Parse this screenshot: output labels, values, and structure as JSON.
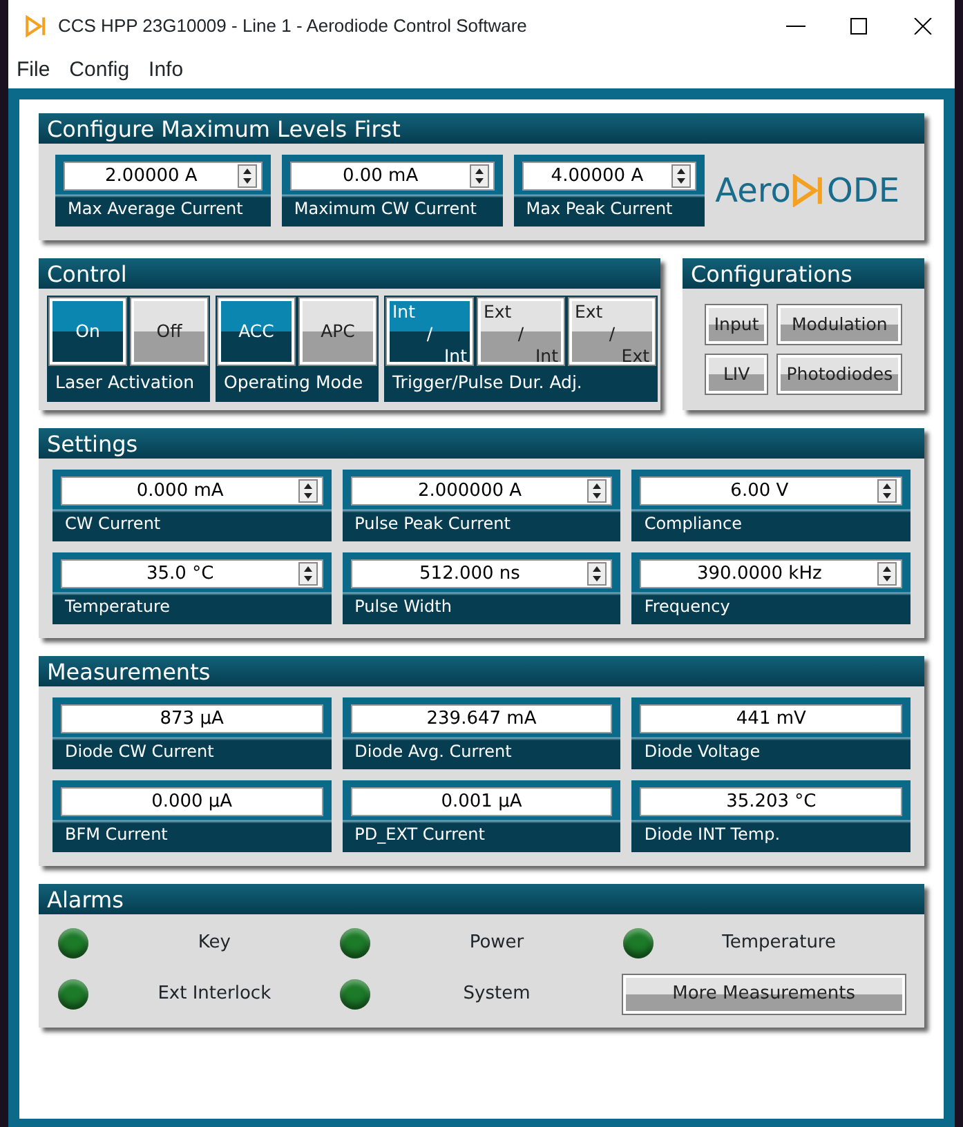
{
  "window": {
    "title": "CCS HPP 23G10009 - Line 1 - Aerodiode Control Software"
  },
  "menu": [
    "File",
    "Config",
    "Info"
  ],
  "max_levels": {
    "title": "Configure Maximum Levels First",
    "fields": [
      {
        "value": "2.00000 A",
        "label": "Max Average Current"
      },
      {
        "value": "0.00 mA",
        "label": "Maximum CW Current"
      },
      {
        "value": "4.00000 A",
        "label": "Max Peak Current"
      }
    ],
    "logo": {
      "left": "Aero",
      "right": "ODE"
    }
  },
  "control": {
    "title": "Control",
    "groups": [
      {
        "label": "Laser Activation",
        "buttons": [
          {
            "lines": [
              "On"
            ],
            "selected": true
          },
          {
            "lines": [
              "Off"
            ],
            "selected": false
          }
        ]
      },
      {
        "label": "Operating Mode",
        "buttons": [
          {
            "lines": [
              "ACC"
            ],
            "selected": true
          },
          {
            "lines": [
              "APC"
            ],
            "selected": false
          }
        ]
      },
      {
        "label": "Trigger/Pulse Dur. Adj.",
        "buttons": [
          {
            "lines": [
              "Int",
              "/",
              "Int"
            ],
            "selected": true
          },
          {
            "lines": [
              "Ext",
              "/",
              "Int"
            ],
            "selected": false
          },
          {
            "lines": [
              "Ext",
              "/",
              "Ext"
            ],
            "selected": false
          }
        ]
      }
    ]
  },
  "configurations": {
    "title": "Configurations",
    "buttons": [
      "Input",
      "Modulation",
      "LIV",
      "Photodiodes"
    ]
  },
  "settings": {
    "title": "Settings",
    "fields": [
      {
        "value": "0.000 mA",
        "label": "CW Current"
      },
      {
        "value": "2.000000 A",
        "label": "Pulse Peak Current"
      },
      {
        "value": "6.00 V",
        "label": "Compliance"
      },
      {
        "value": "35.0 °C",
        "label": "Temperature"
      },
      {
        "value": "512.000 ns",
        "label": "Pulse Width"
      },
      {
        "value": "390.0000 kHz",
        "label": "Frequency"
      }
    ]
  },
  "measurements": {
    "title": "Measurements",
    "fields": [
      {
        "value": "873 µA",
        "label": "Diode CW Current"
      },
      {
        "value": "239.647 mA",
        "label": "Diode Avg. Current"
      },
      {
        "value": "441 mV",
        "label": "Diode Voltage"
      },
      {
        "value": "0.000 µA",
        "label": "BFM Current"
      },
      {
        "value": "0.001 µA",
        "label": "PD_EXT Current"
      },
      {
        "value": "35.203 °C",
        "label": "Diode INT Temp."
      }
    ]
  },
  "alarms": {
    "title": "Alarms",
    "items": [
      {
        "label": "Key",
        "color": "#1c7a28"
      },
      {
        "label": "Power",
        "color": "#1c7a28"
      },
      {
        "label": "Temperature",
        "color": "#1c7a28"
      },
      {
        "label": "Ext Interlock",
        "color": "#1c7a28"
      },
      {
        "label": "System",
        "color": "#1c7a28"
      }
    ],
    "button": "More Measurements"
  }
}
